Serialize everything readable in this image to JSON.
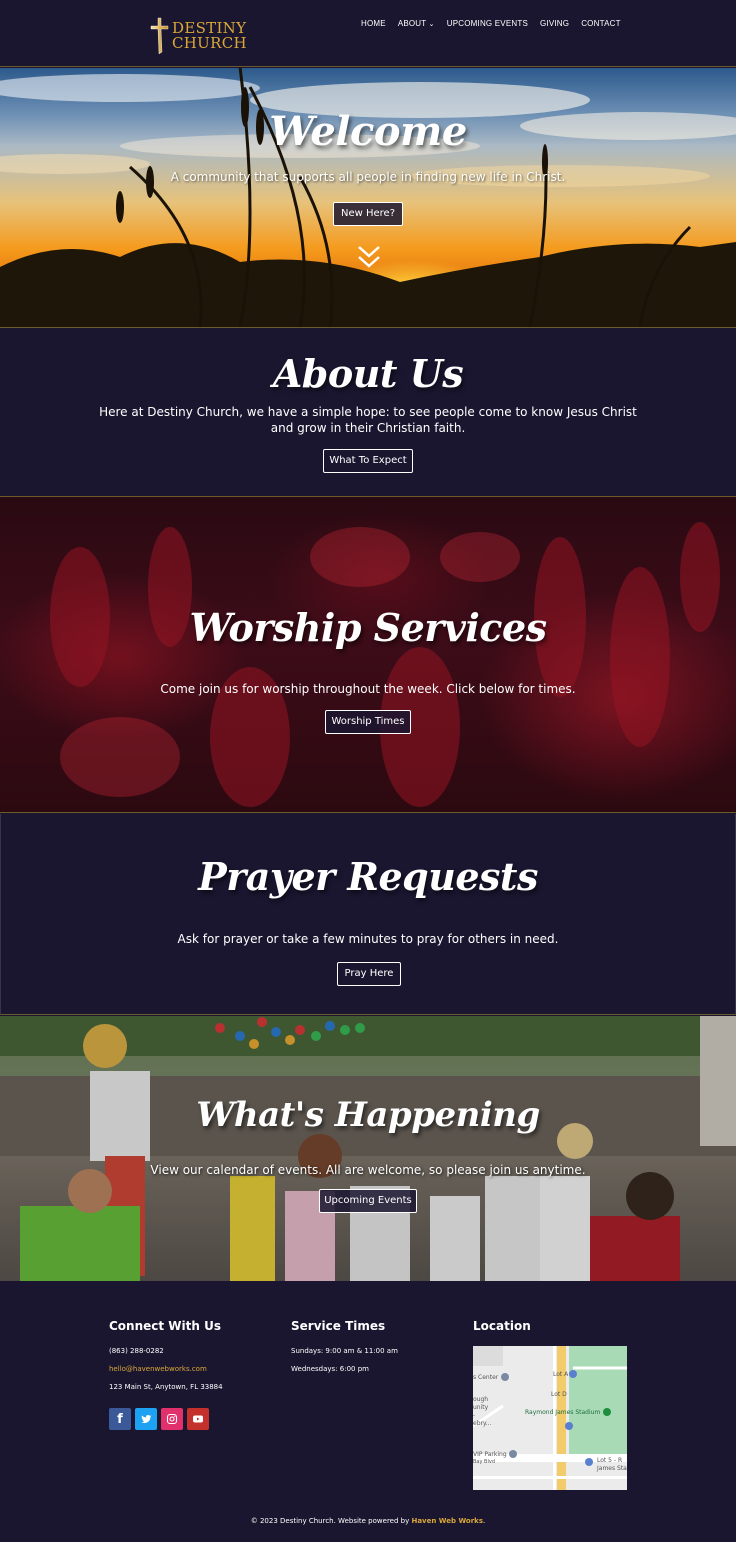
{
  "header": {
    "logo_line1": "DESTINY",
    "logo_line2": "CHURCH",
    "nav": [
      "HOME",
      "ABOUT",
      "UPCOMING EVENTS",
      "GIVING",
      "CONTACT"
    ]
  },
  "hero": {
    "title": "Welcome",
    "subtitle": "A community that supports all people in finding new life in Christ.",
    "button": "New Here?"
  },
  "about": {
    "title": "About Us",
    "text_line1": "Here at Destiny Church, we have a simple hope: to see people come to know Jesus Christ",
    "text_line2": "and grow in their Christian faith.",
    "button": "What To Expect"
  },
  "worship": {
    "title": "Worship Services",
    "text": "Come join us for worship throughout the week.  Click below for times.",
    "button": "Worship Times"
  },
  "prayer": {
    "title": "Prayer Requests",
    "text": "Ask for prayer or take a few minutes to pray for others in need.",
    "button": "Pray Here"
  },
  "happening": {
    "title": "What's Happening",
    "text": "View our calendar of events. All are welcome, so please join us anytime.",
    "button": "Upcoming Events"
  },
  "footer": {
    "connect_title": "Connect With Us",
    "phone": "(863) 288-0282",
    "email": "hello@havenwebworks.com",
    "address": "123 Main St, Anytown, FL 33884",
    "social": [
      "facebook-icon",
      "twitter-icon",
      "instagram-icon",
      "youtube-icon"
    ],
    "service_title": "Service Times",
    "service_sundays": "Sundays: 9:00 am & 11:00 am",
    "service_wednesdays": "Wednesdays: 6:00 pm",
    "location_title": "Location",
    "map_labels": {
      "center": "s Center",
      "lot_a": "Lot A",
      "lot_d": "Lot D",
      "stadium": "Raymond James Stadium",
      "ough": "ough",
      "unity": "unity",
      "dash": "-",
      "ebry": "ebry...",
      "vip": "VIP Parking",
      "bay": "Bay Blvd",
      "lot5": "Lot 5 - R",
      "james": "James Sta"
    },
    "copyright_prefix": "© 2023 Destiny Church. Website powered by ",
    "copyright_link": "Haven Web Works",
    "copyright_suffix": "."
  },
  "colors": {
    "background": "#1b1630",
    "accent_gold": "#d9a838",
    "facebook": "#3b5998",
    "twitter": "#1da1f2",
    "instagram": "#e1306c",
    "youtube": "#c4302b"
  }
}
